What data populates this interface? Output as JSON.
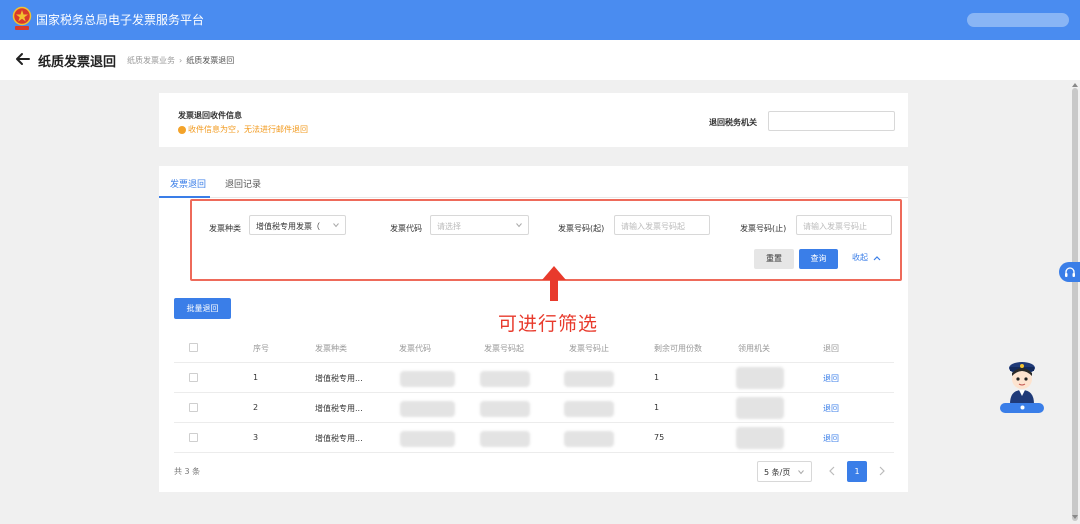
{
  "header": {
    "app_title": "国家税务总局电子发票服务平台"
  },
  "subheader": {
    "page_title": "纸质发票退回",
    "breadcrumb": [
      "纸质发票业务",
      "纸质发票退回"
    ]
  },
  "receive_info": {
    "title": "发票退回收件信息",
    "warning": "收件信息为空，无法进行邮件退回",
    "tax_office_label": "退回税务机关",
    "tax_office_value": ""
  },
  "tabs": [
    {
      "label": "发票退回",
      "active": true
    },
    {
      "label": "退回记录",
      "active": false
    }
  ],
  "filters": {
    "type_label": "发票种类",
    "type_value": "增值税专用发票（",
    "code_label": "发票代码",
    "code_placeholder": "请选择",
    "start_label": "发票号码(起)",
    "start_placeholder": "请输入发票号码起",
    "end_label": "发票号码(止)",
    "end_placeholder": "请输入发票号码止",
    "reset_label": "重置",
    "query_label": "查询",
    "collapse_label": "收起"
  },
  "annotation": {
    "text": "可进行筛选"
  },
  "batch_button": "批量退回",
  "table": {
    "headers": [
      "序号",
      "发票种类",
      "发票代码",
      "发票号码起",
      "发票号码止",
      "剩余可用份数",
      "领用机关",
      "退回"
    ],
    "rows": [
      {
        "index": "1",
        "type": "增值税专用...",
        "remaining": "1",
        "action": "退回"
      },
      {
        "index": "2",
        "type": "增值税专用...",
        "remaining": "1",
        "action": "退回"
      },
      {
        "index": "3",
        "type": "增值税专用...",
        "remaining": "75",
        "action": "退回"
      }
    ]
  },
  "pagination": {
    "total": "共 3 条",
    "page_size": "5 条/页",
    "current_page": "1"
  },
  "colors": {
    "primary": "#3a7ee8",
    "topbar": "#4a8cf0",
    "warning": "#f29a1e",
    "annotation_red": "#e83a2c"
  }
}
